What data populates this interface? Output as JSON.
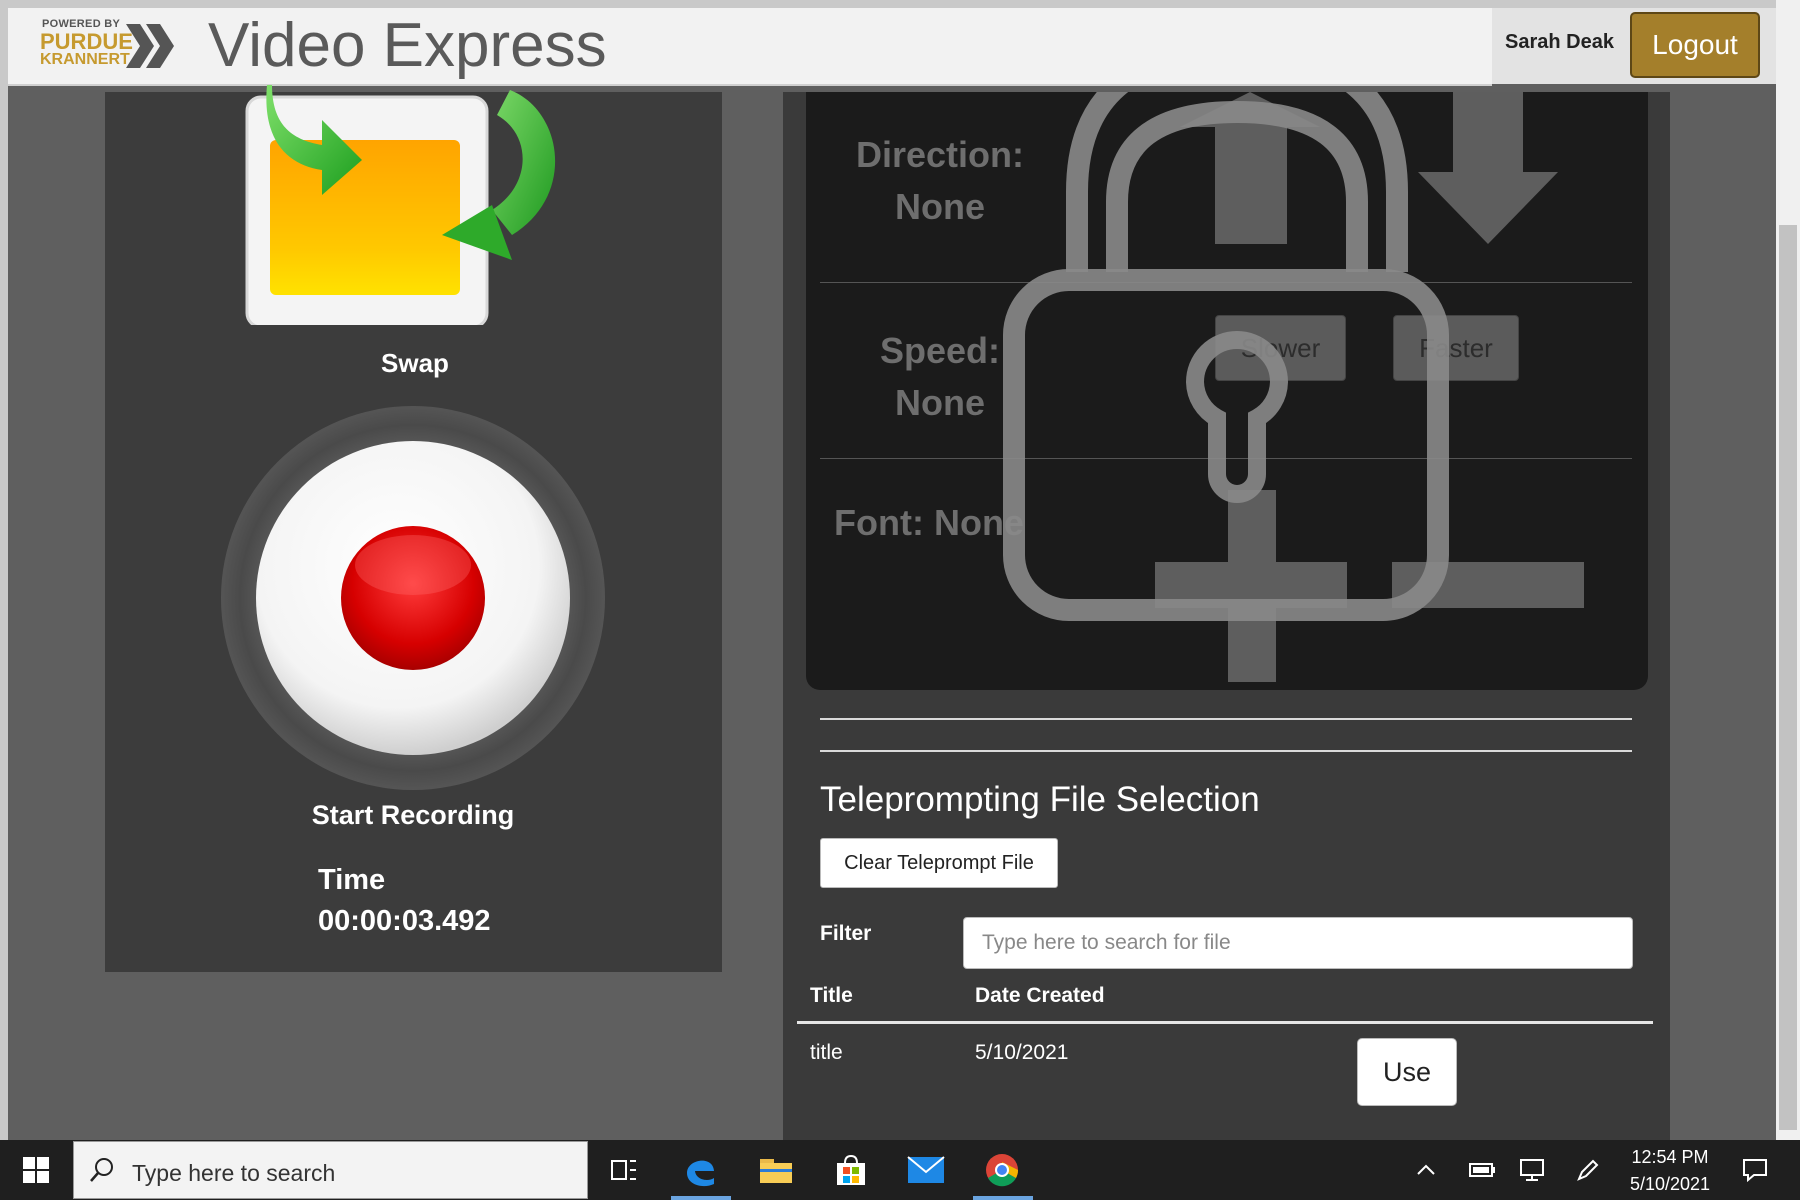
{
  "header": {
    "logo_powered": "POWERED BY",
    "logo_line1": "PURDUE",
    "logo_line2": "KRANNERT",
    "app_title": "Video Express",
    "user_name": "Sarah Deak",
    "logout_label": "Logout"
  },
  "recorder": {
    "swap_label": "Swap",
    "record_label": "Start Recording",
    "time_label": "Time",
    "time_value": "00:00:03.492"
  },
  "controls": {
    "direction_label": "Direction:",
    "direction_value": "None",
    "speed_label": "Speed:",
    "speed_value": "None",
    "slower_label": "Slower",
    "faster_label": "Faster",
    "font_label": "Font: None",
    "locked": true
  },
  "teleprompt": {
    "heading": "Teleprompting File Selection",
    "clear_label": "Clear Teleprompt File",
    "filter_label": "Filter",
    "search_placeholder": "Type here to search for file",
    "columns": [
      "Title",
      "Date Created"
    ],
    "rows": [
      {
        "title": "title",
        "date": "5/10/2021",
        "action": "Use"
      }
    ]
  },
  "taskbar": {
    "search_placeholder": "Type here to search",
    "pinned_icons": [
      "task-view-icon",
      "edge-icon",
      "file-explorer-icon",
      "store-icon",
      "mail-icon",
      "chrome-icon"
    ],
    "tray_icons": [
      "chevron-up-icon",
      "battery-icon",
      "network-icon",
      "pen-icon",
      "notifications-icon"
    ],
    "time": "12:54 PM",
    "date": "5/10/2021"
  },
  "colors": {
    "brand_gold": "#a47f2b",
    "panel_dark": "#3c3c3c",
    "controls_bg": "#1b1b1b",
    "record_red": "#d40000"
  }
}
